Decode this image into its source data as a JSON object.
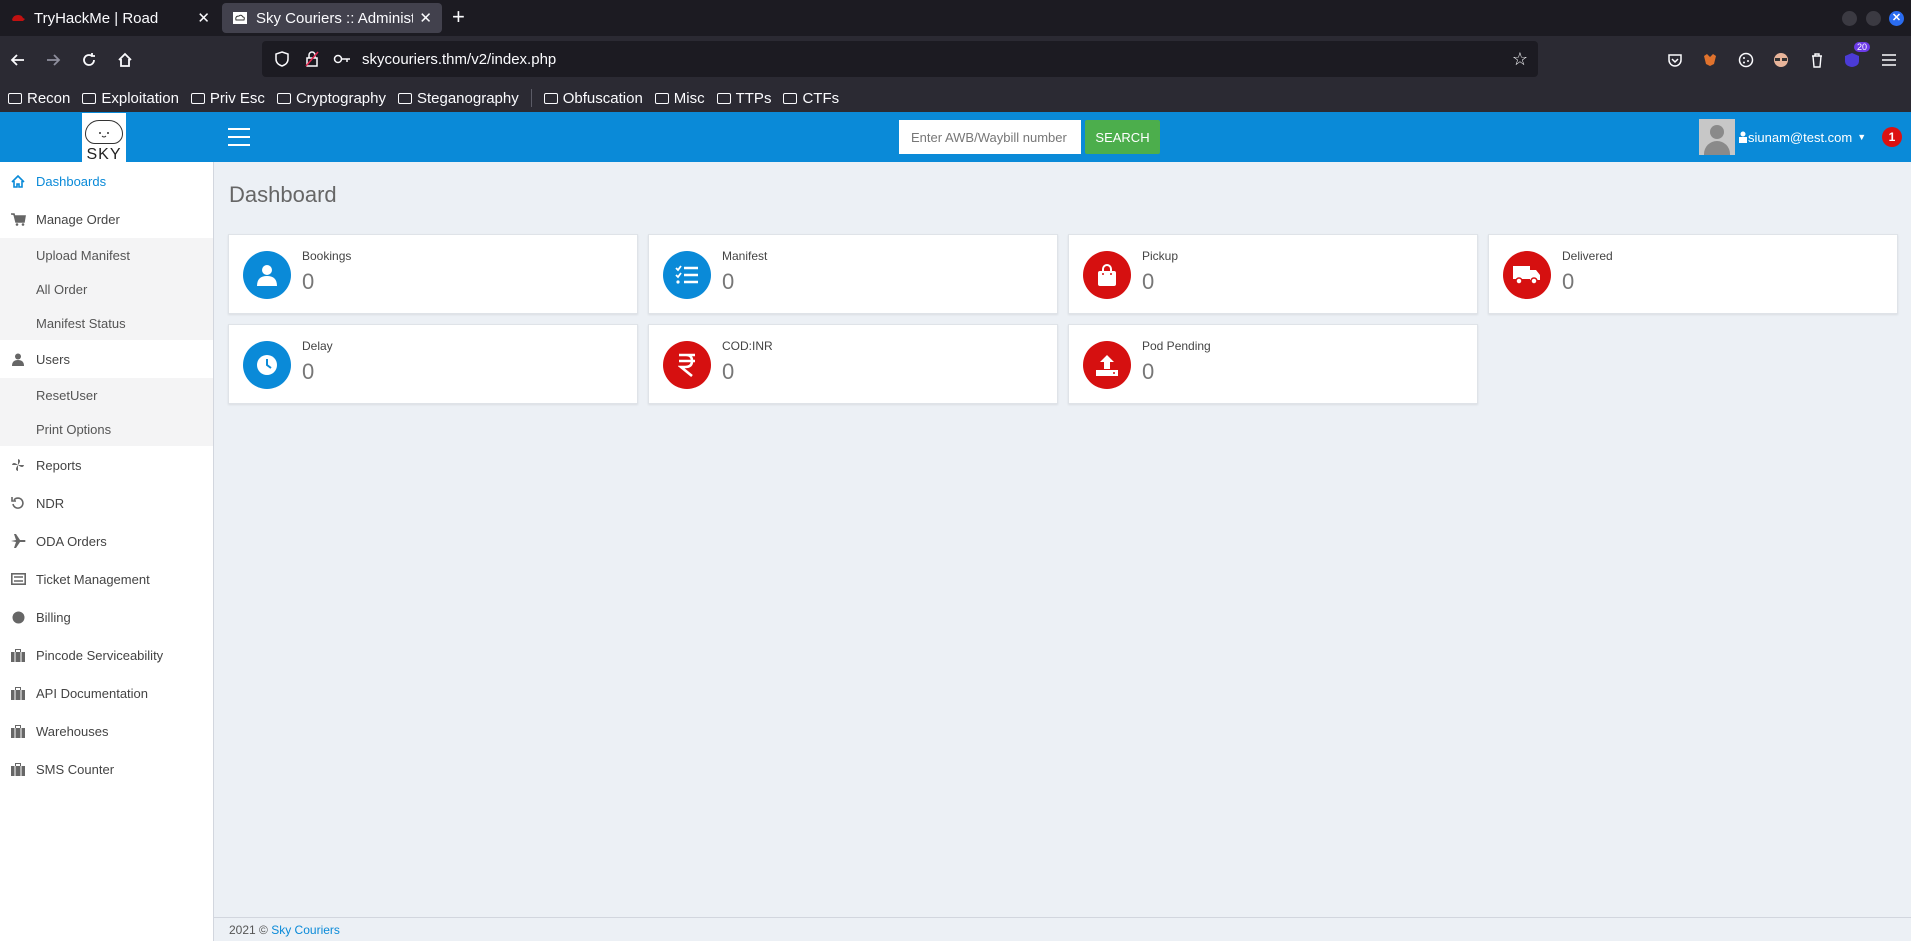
{
  "browser": {
    "tabs": [
      {
        "label": "TryHackMe | Road"
      },
      {
        "label": "Sky Couriers :: Administra"
      }
    ],
    "new_tab": "+",
    "url": "skycouriers.thm/v2/index.php",
    "extension_badge": "20",
    "bookmarks": [
      "Recon",
      "Exploitation",
      "Priv Esc",
      "Cryptography",
      "Steganography",
      "Obfuscation",
      "Misc",
      "TTPs",
      "CTFs"
    ]
  },
  "app": {
    "logo_text": "SKY",
    "search": {
      "placeholder": "Enter AWB/Waybill number",
      "button": "SEARCH"
    },
    "user": {
      "email": "siunam@test.com",
      "notifications": "1"
    },
    "sidebar": {
      "items": [
        {
          "label": "Dashboards",
          "icon": "home-icon"
        },
        {
          "label": "Manage Order",
          "icon": "cart-icon"
        },
        {
          "label": "Upload Manifest"
        },
        {
          "label": "All Order"
        },
        {
          "label": "Manifest Status"
        },
        {
          "label": "Users",
          "icon": "user-icon"
        },
        {
          "label": "ResetUser"
        },
        {
          "label": "Print Options"
        },
        {
          "label": "Reports",
          "icon": "pinwheel-icon"
        },
        {
          "label": "NDR",
          "icon": "undo-icon"
        },
        {
          "label": "ODA Orders",
          "icon": "plane-icon"
        },
        {
          "label": "Ticket Management",
          "icon": "keyboard-icon"
        },
        {
          "label": "Billing",
          "icon": "circle-icon"
        },
        {
          "label": "Pincode Serviceability",
          "icon": "briefcase-icon"
        },
        {
          "label": "API Documentation",
          "icon": "briefcase-icon"
        },
        {
          "label": "Warehouses",
          "icon": "briefcase-icon"
        },
        {
          "label": "SMS Counter",
          "icon": "briefcase-icon"
        }
      ]
    },
    "page_title": "Dashboard",
    "cards": [
      {
        "label": "Bookings",
        "value": "0",
        "color": "#0a8ad8",
        "icon": "user-icon"
      },
      {
        "label": "Manifest",
        "value": "0",
        "color": "#0a8ad8",
        "icon": "list-check-icon"
      },
      {
        "label": "Pickup",
        "value": "0",
        "color": "#d61010",
        "icon": "shopping-bag-icon"
      },
      {
        "label": "Delivered",
        "value": "0",
        "color": "#d61010",
        "icon": "truck-icon"
      },
      {
        "label": "Delay",
        "value": "0",
        "color": "#0a8ad8",
        "icon": "clock-icon"
      },
      {
        "label": "COD:INR",
        "value": "0",
        "color": "#d61010",
        "icon": "rupee-icon"
      },
      {
        "label": "Pod Pending",
        "value": "0",
        "color": "#d61010",
        "icon": "upload-icon"
      }
    ],
    "footer": {
      "text": "2021 © ",
      "link": "Sky Couriers"
    }
  }
}
